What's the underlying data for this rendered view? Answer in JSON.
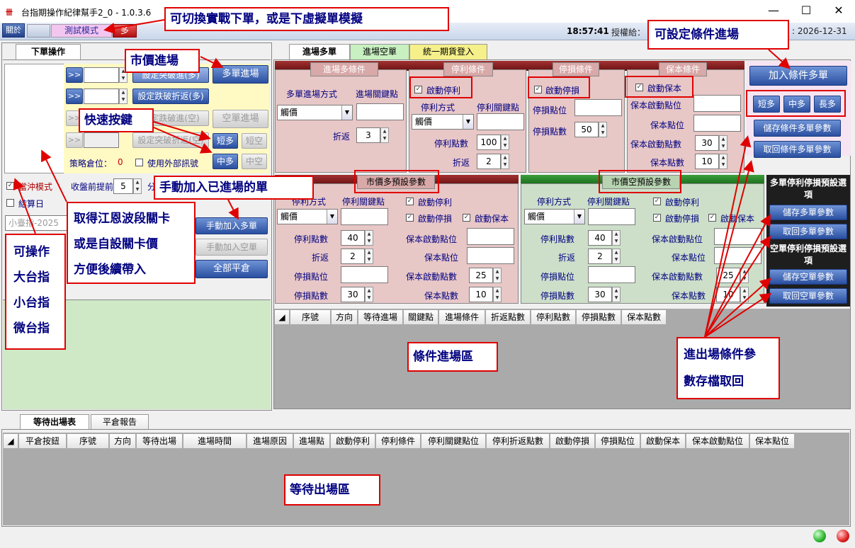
{
  "window": {
    "title": "台指期操作紀律幫手2_0 - 1.0.3.6"
  },
  "toolbar": {
    "close_label": "關於",
    "mode_label": "測試模式",
    "direction_label": "多",
    "time": "18:57:41",
    "license_label": "授權給：",
    "expire": ": 2026-12-31"
  },
  "left": {
    "tab": "下單操作",
    "arrow_label": ">>",
    "btn_rise_break": "設定突破進(多)",
    "btn_rise_pullback": "設定跌破折返(多)",
    "btn_fall_break": "設定跌破進(空)",
    "btn_fall_pullback": "設定突破折返(空)",
    "btn_long_market": "多單進場",
    "btn_short_market": "空單進場",
    "btn_short_long": "短多",
    "btn_short_short": "短空",
    "btn_mid_long": "中多",
    "btn_mid_short": "中空",
    "position_label": "策略倉位：",
    "position_value": "0",
    "external_signal": "使用外部訊號",
    "rush_mode": "當沖模式",
    "settle_day": "結算日",
    "close_early": "收盤前提前",
    "close_early_value": "5",
    "minute_unit": "分",
    "product_value": "小臺指-2025",
    "btn_manual_long": "手動加入多單",
    "btn_manual_short": "手動加入空單",
    "btn_flatten": "全部平倉"
  },
  "right": {
    "tabs": [
      "進場多單",
      "進場空單",
      "統一期貨登入"
    ],
    "entry_header": "進場多條件",
    "entry_method_label": "多單進場方式",
    "entry_key_label": "進場關鍵點",
    "entry_method_value": "觸價",
    "pullback_label": "折返",
    "pullback_value": "3",
    "tp_header": "停利條件",
    "tp_enable": "啟動停利",
    "tp_method_label": "停利方式",
    "tp_key_label": "停利關鍵點",
    "tp_method_value": "觸價",
    "tp_points_label": "停利點數",
    "tp_points_value": "100",
    "tp_pullback_label": "折返",
    "tp_pullback_value": "2",
    "sl_header": "停損條件",
    "sl_enable": "啟動停損",
    "sl_pos_label": "停損點位",
    "sl_points_label": "停損點數",
    "sl_points_value": "50",
    "be_header": "保本條件",
    "be_enable": "啟動保本",
    "be_start_pos_label": "保本啟動點位",
    "be_pos_label": "保本點位",
    "be_start_pts_label": "保本啟動點數",
    "be_start_pts_value": "30",
    "be_pts_label": "保本點數",
    "be_pts_value": "10",
    "btn_add_cond_long": "加入條件多單",
    "btn_short_long": "短多",
    "btn_mid_long": "中多",
    "btn_long_long": "長多",
    "btn_save_cond": "儲存條件多單參數",
    "btn_load_cond": "取回條件多單參數"
  },
  "preset_long": {
    "header": "市價多預設參數",
    "tp_method_label": "停利方式",
    "tp_key_label": "停利關鍵點",
    "tp_method_value": "觸價",
    "tp_points_label": "停利點數",
    "tp_points_value": "40",
    "pullback_label": "折返",
    "pullback_value": "2",
    "sl_pos_label": "停損點位",
    "sl_pts_label": "停損點數",
    "sl_pts_value": "30",
    "tp_enable": "啟動停利",
    "sl_enable": "啟動停損",
    "be_enable": "啟動保本",
    "be_start_pos_label": "保本啟動點位",
    "be_pos_label": "保本點位",
    "be_start_pts_label": "保本啟動點數",
    "be_start_pts_value": "25",
    "be_pts_label": "保本點數",
    "be_pts_value": "10"
  },
  "preset_short": {
    "header": "市價空預設參數",
    "tp_method_label": "停利方式",
    "tp_key_label": "停利關鍵點",
    "tp_method_value": "觸價",
    "tp_points_label": "停利點數",
    "tp_points_value": "40",
    "pullback_label": "折返",
    "pullback_value": "2",
    "sl_pos_label": "停損點位",
    "sl_pts_label": "停損點數",
    "sl_pts_value": "30",
    "tp_enable": "啟動停利",
    "sl_enable": "啟動停損",
    "be_enable": "啟動保本",
    "be_start_pos_label": "保本啟動點位",
    "be_pos_label": "保本點位",
    "be_start_pts_label": "保本啟動點數",
    "be_start_pts_value": "25",
    "be_pts_label": "保本點數",
    "be_pts_value": "10"
  },
  "side": {
    "long_header": "多單停利停損預設選項",
    "save_long": "儲存多單參數",
    "load_long": "取回多單參數",
    "short_header": "空單停利停損預設選項",
    "save_short": "儲存空單參數",
    "load_short": "取回空單參數"
  },
  "cond_table": {
    "columns": [
      "序號",
      "方向",
      "等待進場",
      "關鍵點",
      "進場條件",
      "折返點數",
      "停利點數",
      "停損點數",
      "保本點數"
    ]
  },
  "bottom": {
    "tabs": [
      "等待出場表",
      "平倉報告"
    ],
    "columns": [
      "平倉按鈕",
      "序號",
      "方向",
      "等待出場",
      "進場時間",
      "進場原因",
      "進場點",
      "啟動停利",
      "停利條件",
      "停利關鍵點位",
      "停利折返點數",
      "啟動停損",
      "停損點位",
      "啟動保本",
      "保本啟動點位",
      "保本點位"
    ]
  },
  "annotations": {
    "a1": "可切換實戰下單，或是下虛擬單模擬",
    "a2": "市價進場",
    "a3": "快速按鍵",
    "a4": "手動加入已進場的單",
    "a5": "取得江恩波段關卡",
    "a5b": "或是自設關卡價",
    "a5c": "方便後續帶入",
    "a6": "可操作",
    "a6b": "大台指",
    "a6c": "小台指",
    "a6d": "微台指",
    "a7": "條件進場區",
    "a8": "等待出場區",
    "a9": "可設定條件進場",
    "a10": "進出場條件參",
    "a10b": "數存檔取回"
  },
  "colors": {
    "accent_blue": "#23428a",
    "annot_red": "#e00000",
    "annot_text": "#000080"
  }
}
